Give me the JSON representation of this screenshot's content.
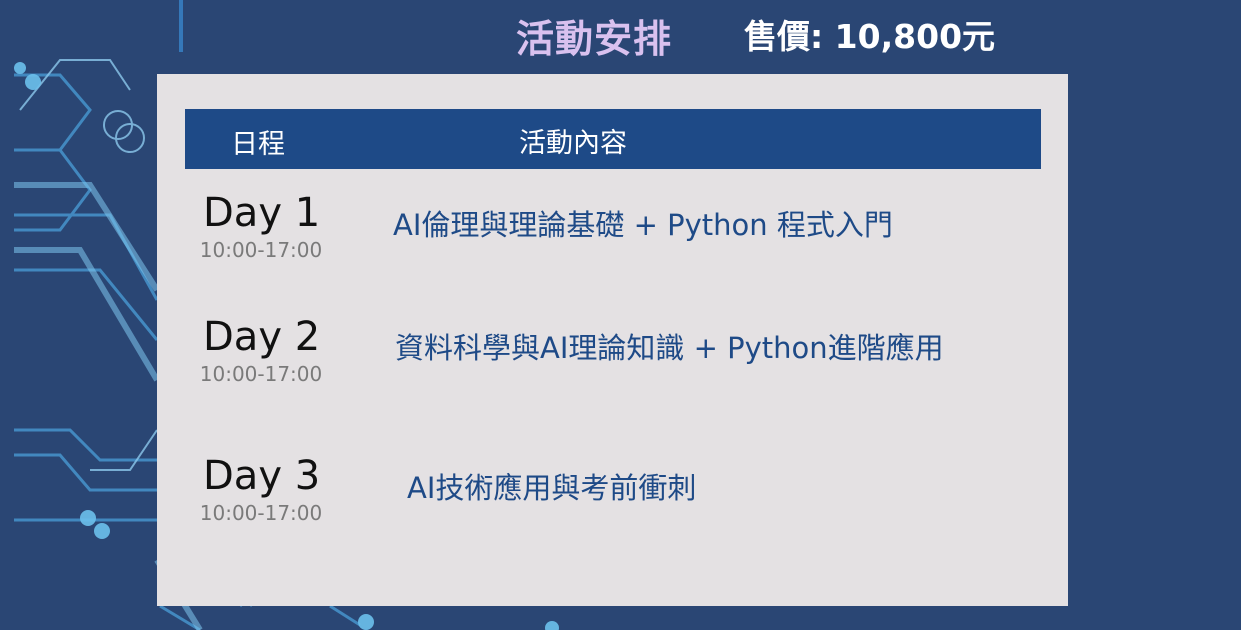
{
  "header": {
    "title": "活動安排",
    "price": "售價: 10,800元"
  },
  "table": {
    "columns": [
      "日程",
      "活動內容"
    ],
    "rows": [
      {
        "day": "Day 1",
        "time": "10:00-17:00",
        "content": "AI倫理與理論基礎 + Python 程式入門"
      },
      {
        "day": "Day 2",
        "time": "10:00-17:00",
        "content": "資料科學與AI理論知識 + Python進階應用"
      },
      {
        "day": "Day 3",
        "time": "10:00-17:00",
        "content": "AI技術應用與考前衝刺"
      }
    ]
  },
  "colors": {
    "background": "#2a4674",
    "panel": "#e4e1e3",
    "header_bar": "#1e4a87",
    "title": "#d9c1ef",
    "content_text": "#1e4a87"
  }
}
